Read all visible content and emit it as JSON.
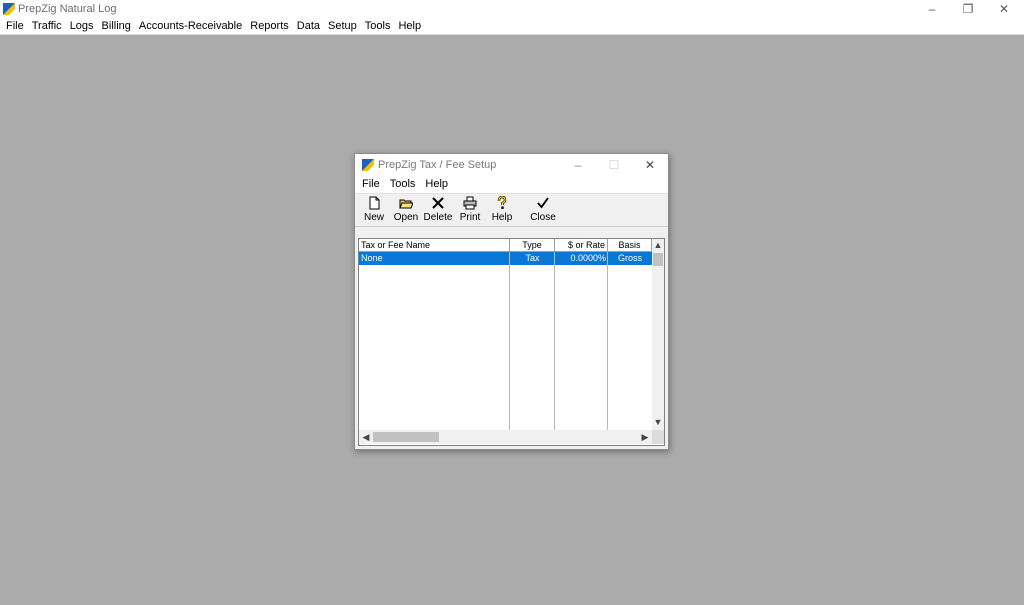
{
  "main_window": {
    "title": "PrepZig Natural Log",
    "menu": [
      "File",
      "Traffic",
      "Logs",
      "Billing",
      "Accounts-Receivable",
      "Reports",
      "Data",
      "Setup",
      "Tools",
      "Help"
    ],
    "controls": {
      "minimize": "–",
      "restore": "❐",
      "close": "✕"
    }
  },
  "dialog": {
    "title": "PrepZig Tax / Fee Setup",
    "menu": [
      "File",
      "Tools",
      "Help"
    ],
    "controls": {
      "minimize": "–",
      "maximize": "☐",
      "close": "✕"
    },
    "toolbar": {
      "new_label": "New",
      "open_label": "Open",
      "delete_label": "Delete",
      "print_label": "Print",
      "help_label": "Help",
      "close_label": "Close"
    },
    "table": {
      "columns": [
        "Tax or Fee Name",
        "Type",
        "$ or Rate",
        "Basis"
      ],
      "rows": [
        {
          "name": "None",
          "type": "Tax",
          "rate": "0.0000%",
          "basis": "Gross",
          "selected": true
        }
      ]
    },
    "scroll_arrows": {
      "up": "▲",
      "down": "▼",
      "left": "◀",
      "right": "▶"
    }
  },
  "colors": {
    "desktop": "#ababab",
    "selection": "#0a78d7",
    "app_icon_blue": "#1f5fbf",
    "app_icon_yellow": "#f2c200"
  }
}
